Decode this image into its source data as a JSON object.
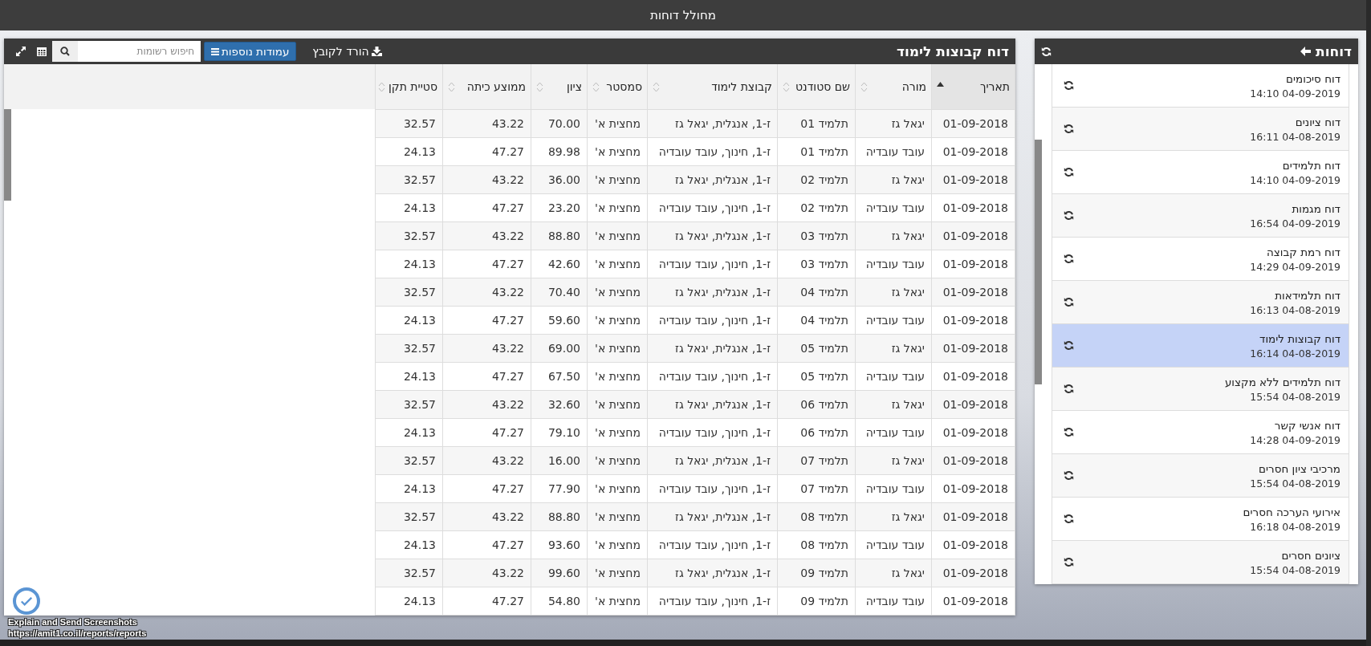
{
  "app_bar": {
    "title": "מחולל דוחות"
  },
  "report": {
    "title": "דוח קבוצות לימוד",
    "download_label": "הורד לקובץ",
    "columns_button": "עמודות נוספות",
    "search": {
      "placeholder": "חיפוש רשומות"
    },
    "columns": [
      {
        "label": "תאריך",
        "sorted": true
      },
      {
        "label": "מורה",
        "sorted": false
      },
      {
        "label": "שם סטודנט",
        "sorted": false
      },
      {
        "label": "קבוצת לימוד",
        "sorted": false
      },
      {
        "label": "סמסטר",
        "sorted": false
      },
      {
        "label": "ציון",
        "sorted": false
      },
      {
        "label": "ממוצע כיתה",
        "sorted": false
      },
      {
        "label": "סטיית תקן",
        "sorted": false
      }
    ],
    "rows": [
      [
        "01-09-2018",
        "יגאל גז",
        "תלמיד 01",
        "ז-1, אנגלית, יגאל גז",
        "מחצית א'",
        "70.00",
        "43.22",
        "32.57"
      ],
      [
        "01-09-2018",
        "עובד עובדיה",
        "תלמיד 01",
        "ז-1, חינוך, עובד עובדיה",
        "מחצית א'",
        "89.98",
        "47.27",
        "24.13"
      ],
      [
        "01-09-2018",
        "יגאל גז",
        "תלמיד 02",
        "ז-1, אנגלית, יגאל גז",
        "מחצית א'",
        "36.00",
        "43.22",
        "32.57"
      ],
      [
        "01-09-2018",
        "עובד עובדיה",
        "תלמיד 02",
        "ז-1, חינוך, עובד עובדיה",
        "מחצית א'",
        "23.20",
        "47.27",
        "24.13"
      ],
      [
        "01-09-2018",
        "יגאל גז",
        "תלמיד 03",
        "ז-1, אנגלית, יגאל גז",
        "מחצית א'",
        "88.80",
        "43.22",
        "32.57"
      ],
      [
        "01-09-2018",
        "עובד עובדיה",
        "תלמיד 03",
        "ז-1, חינוך, עובד עובדיה",
        "מחצית א'",
        "42.60",
        "47.27",
        "24.13"
      ],
      [
        "01-09-2018",
        "יגאל גז",
        "תלמיד 04",
        "ז-1, אנגלית, יגאל גז",
        "מחצית א'",
        "70.40",
        "43.22",
        "32.57"
      ],
      [
        "01-09-2018",
        "עובד עובדיה",
        "תלמיד 04",
        "ז-1, חינוך, עובד עובדיה",
        "מחצית א'",
        "59.60",
        "47.27",
        "24.13"
      ],
      [
        "01-09-2018",
        "יגאל גז",
        "תלמיד 05",
        "ז-1, אנגלית, יגאל גז",
        "מחצית א'",
        "69.00",
        "43.22",
        "32.57"
      ],
      [
        "01-09-2018",
        "עובד עובדיה",
        "תלמיד 05",
        "ז-1, חינוך, עובד עובדיה",
        "מחצית א'",
        "67.50",
        "47.27",
        "24.13"
      ],
      [
        "01-09-2018",
        "יגאל גז",
        "תלמיד 06",
        "ז-1, אנגלית, יגאל גז",
        "מחצית א'",
        "32.60",
        "43.22",
        "32.57"
      ],
      [
        "01-09-2018",
        "עובד עובדיה",
        "תלמיד 06",
        "ז-1, חינוך, עובד עובדיה",
        "מחצית א'",
        "79.10",
        "47.27",
        "24.13"
      ],
      [
        "01-09-2018",
        "יגאל גז",
        "תלמיד 07",
        "ז-1, אנגלית, יגאל גז",
        "מחצית א'",
        "16.00",
        "43.22",
        "32.57"
      ],
      [
        "01-09-2018",
        "עובד עובדיה",
        "תלמיד 07",
        "ז-1, חינוך, עובד עובדיה",
        "מחצית א'",
        "77.90",
        "47.27",
        "24.13"
      ],
      [
        "01-09-2018",
        "יגאל גז",
        "תלמיד 08",
        "ז-1, אנגלית, יגאל גז",
        "מחצית א'",
        "88.80",
        "43.22",
        "32.57"
      ],
      [
        "01-09-2018",
        "עובד עובדיה",
        "תלמיד 08",
        "ז-1, חינוך, עובד עובדיה",
        "מחצית א'",
        "93.60",
        "47.27",
        "24.13"
      ],
      [
        "01-09-2018",
        "יגאל גז",
        "תלמיד 09",
        "ז-1, אנגלית, יגאל גז",
        "מחצית א'",
        "99.60",
        "43.22",
        "32.57"
      ],
      [
        "01-09-2018",
        "עובד עובדיה",
        "תלמיד 09",
        "ז-1, חינוך, עובד עובדיה",
        "מחצית א'",
        "54.80",
        "47.27",
        "24.13"
      ]
    ]
  },
  "sidebar": {
    "title": "דוחות",
    "items": [
      {
        "name": "דוח סיכומים",
        "date": "14:10 04-09-2019",
        "selected": false
      },
      {
        "name": "דוח ציונים",
        "date": "16:11 04-08-2019",
        "selected": false
      },
      {
        "name": "דוח תלמידים",
        "date": "14:10 04-09-2019",
        "selected": false
      },
      {
        "name": "דוח מגמות",
        "date": "16:54 04-09-2019",
        "selected": false
      },
      {
        "name": "דוח רמת קבוצה",
        "date": "14:29 04-09-2019",
        "selected": false
      },
      {
        "name": "דוח תלמידאות",
        "date": "16:13 04-08-2019",
        "selected": false
      },
      {
        "name": "דוח קבוצות לימוד",
        "date": "16:14 04-08-2019",
        "selected": true
      },
      {
        "name": "דוח תלמידים ללא מקצוע",
        "date": "15:54 04-08-2019",
        "selected": false
      },
      {
        "name": "דוח אנשי קשר",
        "date": "14:28 04-09-2019",
        "selected": false
      },
      {
        "name": "מרכיבי ציון חסרים",
        "date": "15:54 04-08-2019",
        "selected": false
      },
      {
        "name": "אירועי הערכה חסרים",
        "date": "16:18 04-08-2019",
        "selected": false
      },
      {
        "name": "ציונים חסרים",
        "date": "15:54 04-08-2019",
        "selected": false
      }
    ]
  },
  "overlay": {
    "label": "Explain and Send Screenshots",
    "url": "https://amit1.co.il/reports/reports"
  }
}
